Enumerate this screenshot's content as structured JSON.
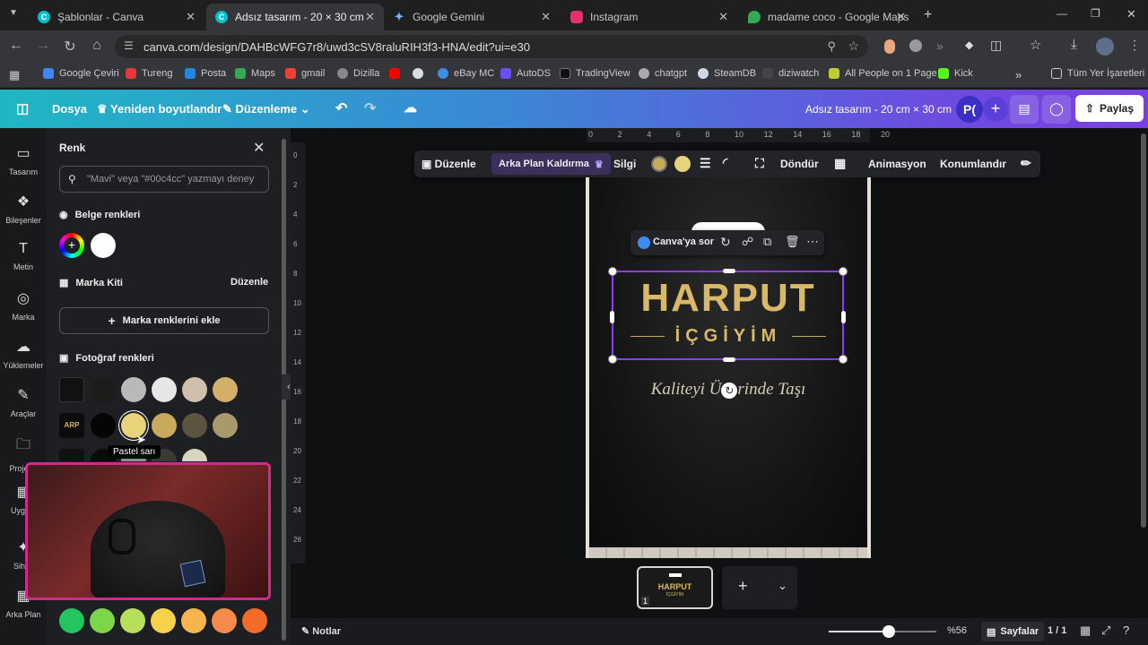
{
  "tabs": [
    {
      "label": "Şablonlar - Canva",
      "icon": "canva-icon",
      "color": "#00c4cc"
    },
    {
      "label": "Adsız tasarım - 20 × 30 cm",
      "icon": "canva-icon",
      "color": "#00c4cc"
    },
    {
      "label": "Google Gemini",
      "icon": "gemini-icon",
      "color": "#4e8cff"
    },
    {
      "label": "Instagram",
      "icon": "instagram-icon",
      "color": "#e1306c"
    },
    {
      "label": "madame coco - Google Maps",
      "icon": "maps-icon",
      "color": "#34a853"
    }
  ],
  "url": "canva.com/design/DAHBcWFG7r8/uwd3cSV8raluRIH3f3-HNA/edit?ui=e30",
  "bookmarks": [
    "Google Çeviri",
    "Tureng",
    "Posta",
    "Maps",
    "gmail",
    "Dizilla",
    "",
    "",
    "eBay MC",
    "AutoDS",
    "TradingView",
    "chatgpt",
    "SteamDB",
    "diziwatch",
    "All People on 1 Page",
    "Kick"
  ],
  "bookmarks_other": "Tüm Yer İşaretleri",
  "canva": {
    "file": "Dosya",
    "resize": "Yeniden boyutlandır",
    "edit_mode": "Düzenleme",
    "title": "Adsız tasarım - 20 cm × 30 cm",
    "avatar": "P(",
    "share": "Paylaş"
  },
  "rail": [
    "Tasarım",
    "Bileşenler",
    "Metin",
    "Marka",
    "Yüklemeler",
    "Araçlar",
    "Projeler",
    "Uygula",
    "Sihirli",
    "Arka Plan"
  ],
  "panel": {
    "title": "Renk",
    "search_placeholder": "\"Mavi\" veya \"#00c4cc\" yazmayı deney",
    "doc_colors": "Belge renkleri",
    "brand_kit": "Marka Kiti",
    "brand_edit": "Düzenle",
    "add_brand": "Marka renklerini ekle",
    "photo_colors": "Fotoğraf renkleri",
    "tooltip": "Pastel sarı",
    "row1": [
      "#1c1c1a",
      "#b9b9b9",
      "#e6e6e6",
      "#cfc0ad",
      "#d2b06a"
    ],
    "row2": [
      "#050505",
      "#e8d27a",
      "#c9a95c",
      "#5d5440",
      "#a89a6c"
    ],
    "row3": [
      "#0a0a0a",
      "#8e8e8e",
      "#3c3a35",
      "#d9d5c0"
    ],
    "bottom": [
      "#22c55e",
      "#7bd64b",
      "#b7e05a",
      "#f7d14c",
      "#f8b54e",
      "#f58a4b",
      "#f46a28"
    ]
  },
  "ruler_top": [
    "0",
    "2",
    "4",
    "6",
    "8",
    "10",
    "12",
    "14",
    "16",
    "18",
    "20"
  ],
  "ruler_left": [
    "0",
    "2",
    "4",
    "6",
    "8",
    "10",
    "12",
    "14",
    "16",
    "18",
    "20",
    "22",
    "24",
    "26"
  ],
  "context": {
    "edit": "Düzenle",
    "bg_remove": "Arka Plan Kaldırma",
    "eraser": "Silgi",
    "rotate": "Döndür",
    "animate": "Animasyon",
    "position": "Konumlandır",
    "swatch1": "#c9a95c",
    "swatch2": "#e8d27a"
  },
  "element": {
    "ask": "Canva'ya sor"
  },
  "design": {
    "brand": "HARPUT",
    "sub": "İÇGİYİM",
    "slogan_left": "Kaliteyi Ü",
    "slogan_right": "rinde Taşı"
  },
  "thumb": {
    "num": "1",
    "brand": "HARPUT",
    "sub": "İÇGİYİM"
  },
  "bottom": {
    "notes": "Notlar",
    "zoom": "%56",
    "zoom_level": 0.56,
    "pages": "Sayfalar",
    "page_count": "1 / 1"
  }
}
